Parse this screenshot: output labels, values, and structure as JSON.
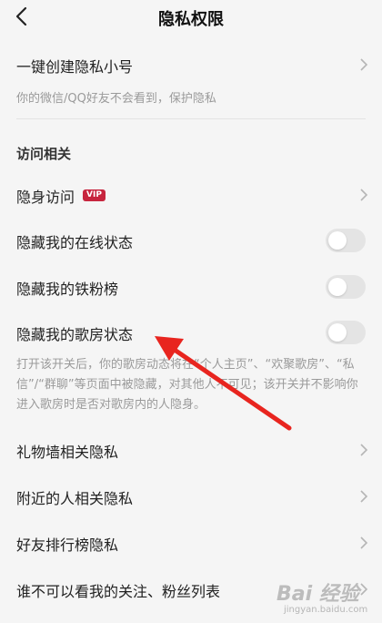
{
  "header": {
    "title": "隐私权限",
    "back_icon": "chevron-left-icon"
  },
  "create_private": {
    "label": "一键创建隐私小号",
    "subtext": "你的微信/QQ好友不会看到，保护隐私"
  },
  "access_section": {
    "title": "访问相关"
  },
  "items": {
    "stealth_visit": {
      "label": "隐身访问",
      "badge": "VIP"
    },
    "hide_online": {
      "label": "隐藏我的在线状态"
    },
    "hide_fans": {
      "label": "隐藏我的铁粉榜"
    },
    "hide_room": {
      "label": "隐藏我的歌房状态"
    }
  },
  "room_description": "打开该开关后，你的歌房动态将在“个人主页”、“欢聚歌房”、“私信”/“群聊”等页面中被隐藏，对其他人不可见；该开关并不影响你进入歌房时是否对歌房内的人隐身。",
  "menu": {
    "gift_wall": "礼物墙相关隐私",
    "nearby": "附近的人相关隐私",
    "friend_rank": "好友排行榜隐私",
    "follow_list": "谁不可以看我的关注、粉丝列表"
  },
  "toggles": {
    "hide_online": false,
    "hide_fans": false,
    "hide_room": false
  },
  "colors": {
    "background": "#f5f5f5",
    "vip_badge": "#c7253e",
    "arrow": "#e8251f",
    "toggle_off": "#e4e4e4"
  },
  "watermark": {
    "text": "Bai 经验",
    "sub": "jingyan.baidu.com"
  }
}
